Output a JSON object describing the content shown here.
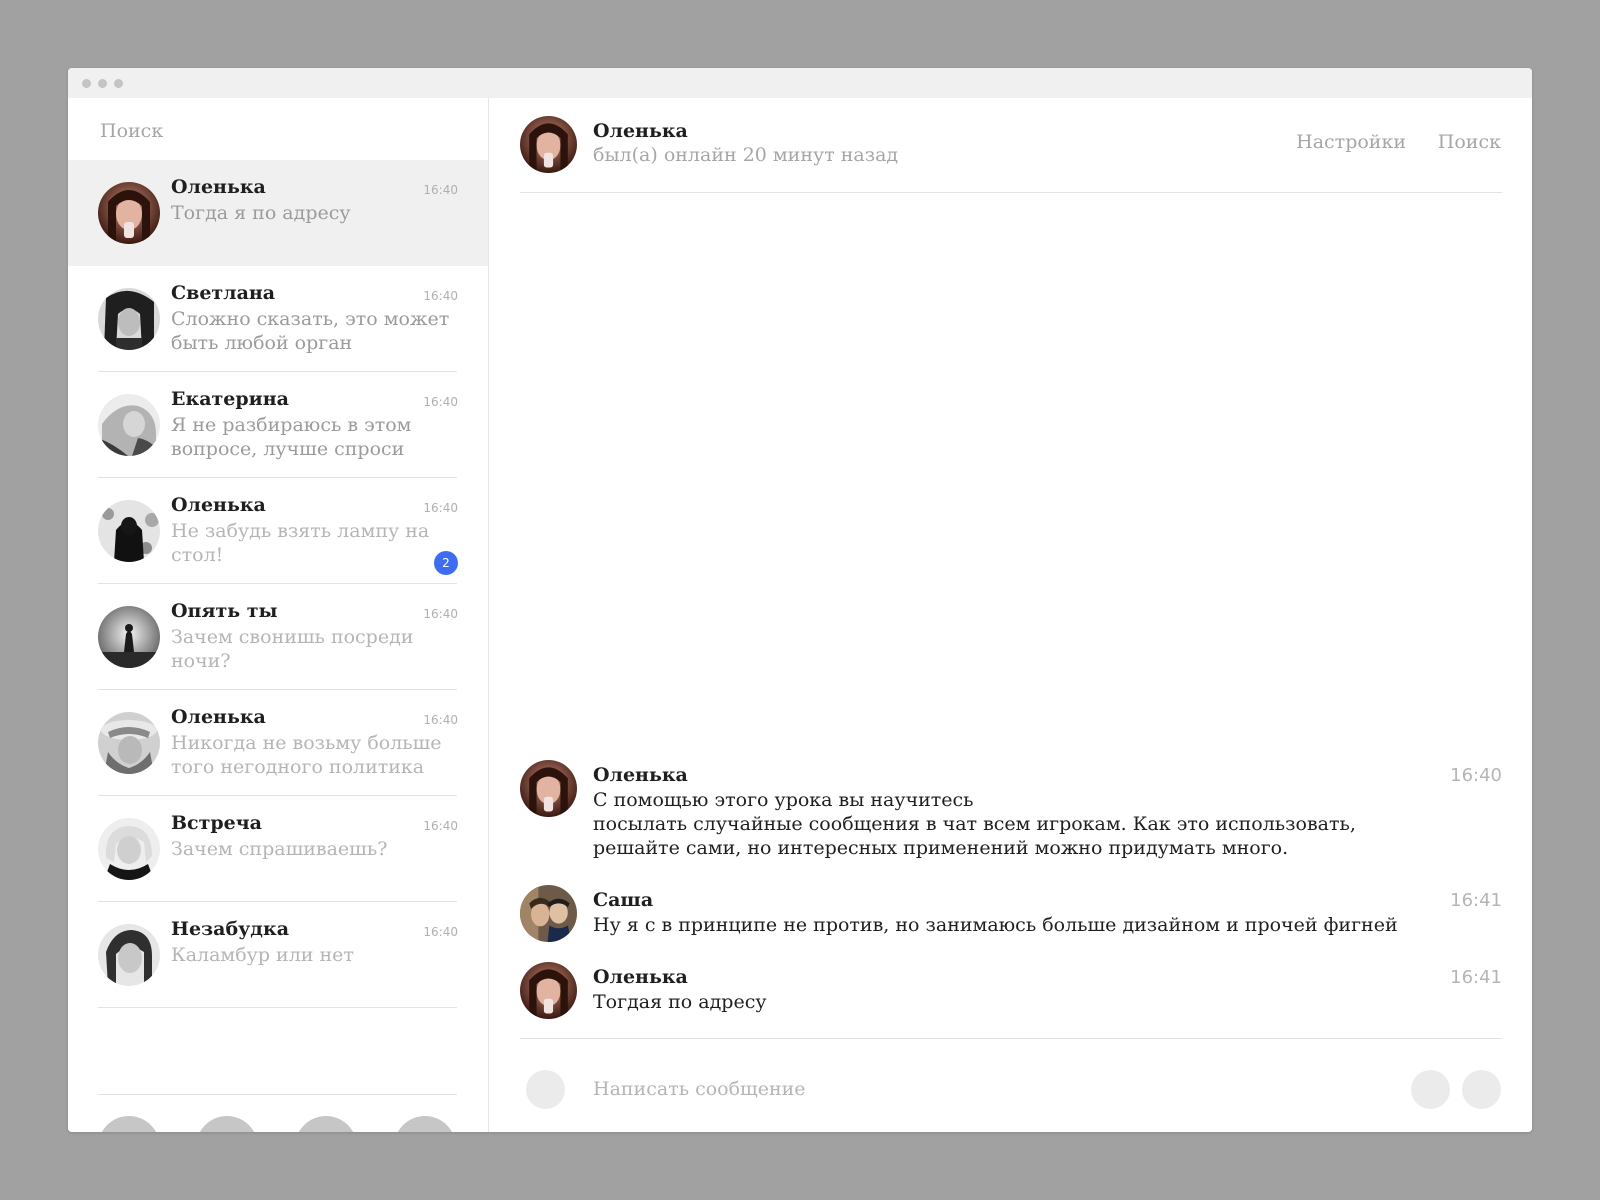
{
  "sidebar": {
    "search_placeholder": "Поиск",
    "conversations": [
      {
        "name": "Оленька",
        "time": "16:40",
        "preview": "Тогда я по адресу",
        "unread": ""
      },
      {
        "name": "Светлана",
        "time": "16:40",
        "preview": "Сложно сказать, это может быть любой орган",
        "unread": ""
      },
      {
        "name": "Екатерина",
        "time": "16:40",
        "preview": "Я не разбираюсь в этом вопросе, лучше спроси",
        "unread": ""
      },
      {
        "name": "Оленька",
        "time": "16:40",
        "preview": "Не забудь взять лампу на стол!",
        "unread": "2"
      },
      {
        "name": "Опять ты",
        "time": "16:40",
        "preview": "Зачем свонишь посреди ночи?",
        "unread": ""
      },
      {
        "name": "Оленька",
        "time": "16:40",
        "preview": "Никогда не возьму больше того негодного политика",
        "unread": ""
      },
      {
        "name": "Встреча",
        "time": "16:40",
        "preview": "Зачем спрашиваешь?",
        "unread": ""
      },
      {
        "name": "Незабудка",
        "time": "16:40",
        "preview": "Каламбур или нет",
        "unread": ""
      }
    ]
  },
  "chat": {
    "header": {
      "name": "Оленька",
      "status": "был(а) онлайн 20 минут назад",
      "settings_label": "Настройки",
      "search_label": "Поиск"
    },
    "messages": [
      {
        "author": "Оленька",
        "time": "16:40",
        "lines": [
          "С помощью этого урока вы научитесь",
          "посылать случайные сообщения в чат всем игрокам. Как это использовать,",
          "решайте сами, но интересных применений можно придумать много."
        ]
      },
      {
        "author": "Саша",
        "time": "16:41",
        "lines": [
          "Ну я с в принципе не против, но занимаюсь больше дизайном и прочей фигней"
        ]
      },
      {
        "author": "Оленька",
        "time": "16:41",
        "lines": [
          "Тогдая по адресу"
        ]
      }
    ],
    "composer_placeholder": "Написать сообщение"
  },
  "colors": {
    "background": "#a1a1a1",
    "active_row": "#f0f0f0",
    "badge": "#3f6df2",
    "muted_text": "#a6a6a6",
    "primary_text": "#1f1f1f"
  }
}
